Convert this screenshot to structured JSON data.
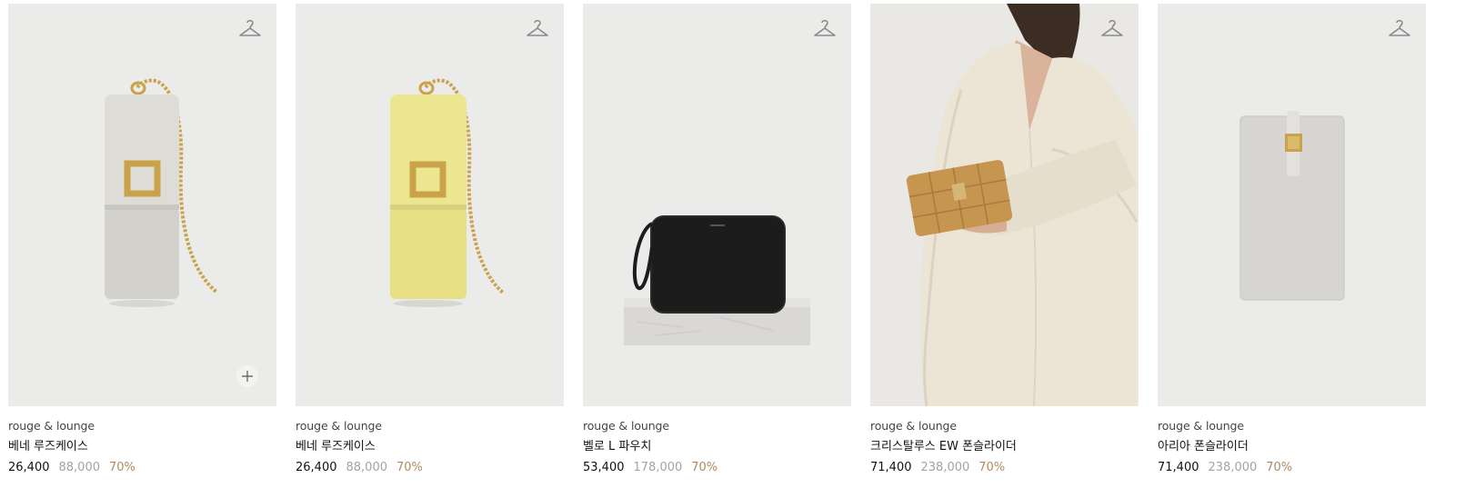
{
  "colors": {
    "card_bg": "#ebebea",
    "discount": "#b08a63",
    "original_price": "#a3a3a3",
    "icon": "#8a8a8a"
  },
  "products": [
    {
      "brand": "rouge & lounge",
      "name": "베네 루즈케이스",
      "price": "26,400",
      "original_price": "88,000",
      "discount": "70%",
      "image": "light-gray-lipstick-case-with-gold-chain",
      "has_quick_add": true
    },
    {
      "brand": "rouge & lounge",
      "name": "베네 루즈케이스",
      "price": "26,400",
      "original_price": "88,000",
      "discount": "70%",
      "image": "yellow-lipstick-case-with-gold-chain",
      "has_quick_add": false
    },
    {
      "brand": "rouge & lounge",
      "name": "벨로 L 파우치",
      "price": "53,400",
      "original_price": "178,000",
      "discount": "70%",
      "image": "black-pouch-on-marble-block",
      "has_quick_add": false
    },
    {
      "brand": "rouge & lounge",
      "name": "크리스탈루스 EW 폰슬라이더",
      "price": "71,400",
      "original_price": "238,000",
      "discount": "70%",
      "image": "model-holding-tan-quilted-wallet",
      "has_quick_add": false
    },
    {
      "brand": "rouge & lounge",
      "name": "아리아 폰슬라이더",
      "price": "71,400",
      "original_price": "238,000",
      "discount": "70%",
      "image": "light-gray-phone-slider-case",
      "has_quick_add": false
    }
  ]
}
